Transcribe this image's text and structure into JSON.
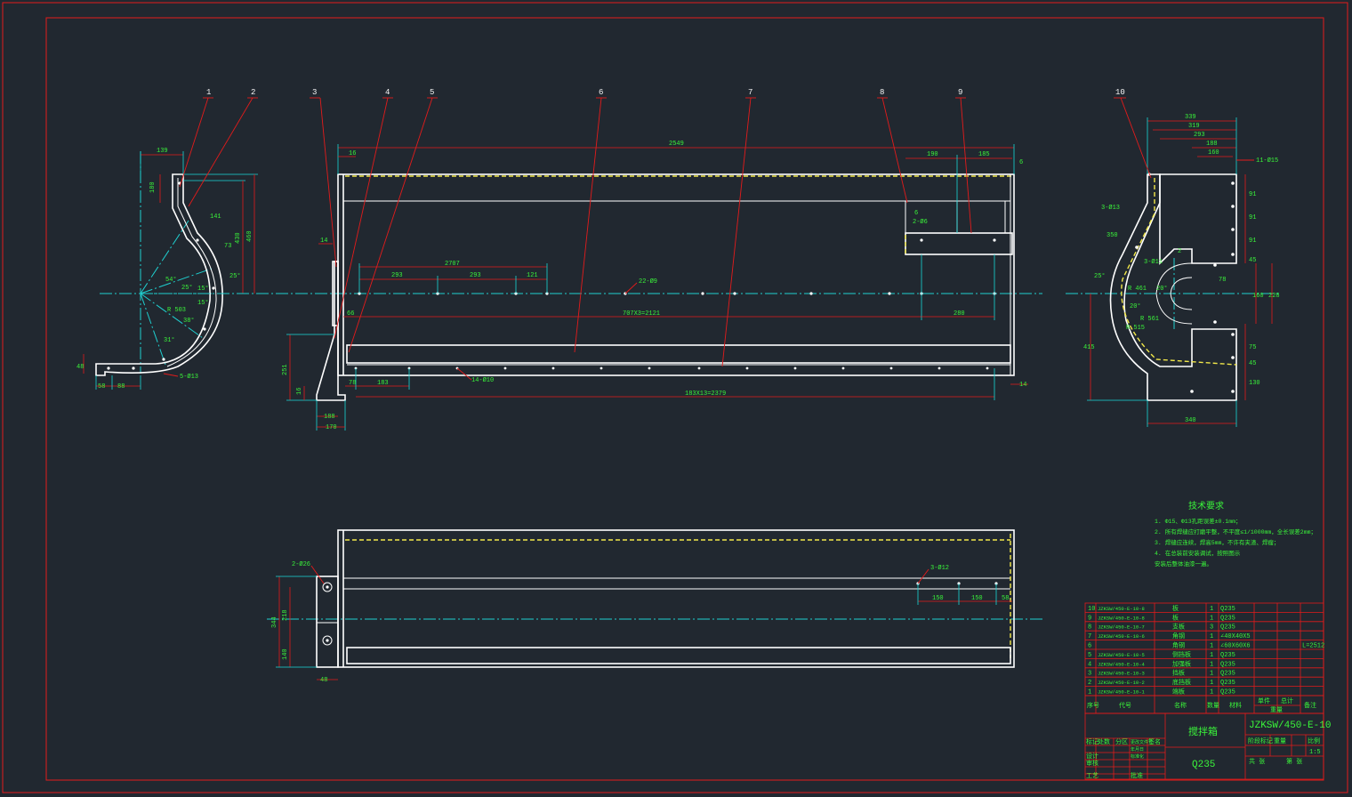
{
  "balloons": [
    "1",
    "2",
    "3",
    "4",
    "5",
    "6",
    "7",
    "8",
    "9",
    "10"
  ],
  "left_view_dims": {
    "top_width": "139",
    "d_180": "180",
    "d_430": "430",
    "d_460": "460",
    "d_141": "141",
    "d_73": "73",
    "ang_25": "25°",
    "ang_54": "54°",
    "ang_25b": "25°",
    "ang_15": "15°",
    "ang_15b": "15°",
    "ang_38": "38°",
    "ang_31": "31°",
    "d_48": "48",
    "d_58": "58",
    "d_88": "88",
    "holes": "5-Ø13",
    "r_label": "R 503"
  },
  "front_view_dims": {
    "overall": "2549",
    "d_16": "16",
    "d_6a": "6",
    "d_190": "190",
    "d_185": "185",
    "d_14a": "14",
    "d_6b": "6",
    "d_2o6": "2-Ø6",
    "d_2707": "2707",
    "d_293a": "293",
    "d_293b": "293",
    "d_121": "121",
    "d_22o9": "22-Ø9",
    "d_66": "66",
    "d_chain": "707X3=2121",
    "d_280": "280",
    "d_251": "251",
    "d_16b": "16",
    "d_78": "78",
    "d_183": "183",
    "d_14o10": "14-Ø10",
    "d_bottom_chain": "183X13=2379",
    "d_14b": "14",
    "d_188": "188",
    "d_170": "170"
  },
  "right_view_dims": {
    "d_339": "339",
    "d_319": "319",
    "d_293": "293",
    "d_188": "188",
    "d_160": "160",
    "d_note": "11-Ø15",
    "d_3o13": "3-Ø13",
    "d_350": "350",
    "d_25": "25°",
    "d_3o11": "3-Ø11",
    "d_20a": "20°",
    "d_r461": "R 461",
    "d_20b": "20°",
    "d_r561": "R 561",
    "d_r515": "R 515",
    "d_2": "2",
    "d_78": "78",
    "d_91a": "91",
    "d_91b": "91",
    "d_91c": "91",
    "d_45": "45",
    "d_160v": "160",
    "d_228": "228",
    "d_75": "75",
    "d_45b": "45",
    "d_130": "130",
    "d_415": "415",
    "d_340": "340"
  },
  "top_view_dims": {
    "d_2o26": "2-Ø26",
    "d_344": "344",
    "d_218": "218",
    "d_140": "140",
    "d_48": "48",
    "d_3o12": "3-Ø12",
    "d_150a": "150",
    "d_150b": "150",
    "d_58": "58"
  },
  "notes": {
    "title": "技术要求",
    "items": [
      "1.  Φ15、Φ13孔距误差±0.1mm；",
      "2.  所有焊缝应打磨平整，不平度≤1/1000mm，全长误差2mm；",
      "3.  焊缝应连续，焊高5mm，不许有夹渣、焊瘤；",
      "4.  在总装前安装调试，按照图示",
      "     安装后整体油漆一遍。"
    ]
  },
  "bom": {
    "rows": [
      {
        "no": "10",
        "code": "JZKSW/450-E-10-8",
        "name": "板",
        "qty": "1",
        "mat": "Q235",
        "note": ""
      },
      {
        "no": "9",
        "code": "JZKSW/450-E-10-8",
        "name": "板",
        "qty": "1",
        "mat": "Q235",
        "note": ""
      },
      {
        "no": "8",
        "code": "JZKSW/450-E-10-7",
        "name": "支板",
        "qty": "3",
        "mat": "Q235",
        "note": ""
      },
      {
        "no": "7",
        "code": "JZKSW/450-E-10-6",
        "name": "角钢",
        "qty": "1",
        "mat": "∠40X40X5",
        "note": ""
      },
      {
        "no": "6",
        "code": "",
        "name": "角钢",
        "qty": "1",
        "mat": "∠60X60X6",
        "note": "L=2512"
      },
      {
        "no": "5",
        "code": "JZKSW/450-E-10-5",
        "name": "侧挡板",
        "qty": "1",
        "mat": "Q235",
        "note": ""
      },
      {
        "no": "4",
        "code": "JZKSW/450-E-10-4",
        "name": "加强板",
        "qty": "1",
        "mat": "Q235",
        "note": ""
      },
      {
        "no": "3",
        "code": "JZKSW/450-E-10-3",
        "name": "挡板",
        "qty": "1",
        "mat": "Q235",
        "note": ""
      },
      {
        "no": "2",
        "code": "JZKSW/450-E-10-2",
        "name": "底挡板",
        "qty": "1",
        "mat": "Q235",
        "note": ""
      },
      {
        "no": "1",
        "code": "JZKSW/450-E-10-1",
        "name": "端板",
        "qty": "1",
        "mat": "Q235",
        "note": ""
      }
    ],
    "header": {
      "no": "序号",
      "code": "代号",
      "name": "名称",
      "qty": "数量",
      "mat": "材料",
      "weight_single": "单件",
      "weight_total": "总计",
      "weight": "重量",
      "note": "备注"
    }
  },
  "title_block": {
    "drawing_no": "JZKSW/450-E-10",
    "name": "搅拌箱",
    "material": "Q235",
    "stage": "阶段标记",
    "mass": "重量",
    "scale": "比例",
    "scale_value": "1:5",
    "sheet": "共 张",
    "sheet_of": "第 张",
    "rows": [
      "标记",
      "处数",
      "分区",
      "更改文件号",
      "签名",
      "年月日",
      "设计",
      "标准化",
      "审核",
      "工艺",
      "批准"
    ]
  }
}
